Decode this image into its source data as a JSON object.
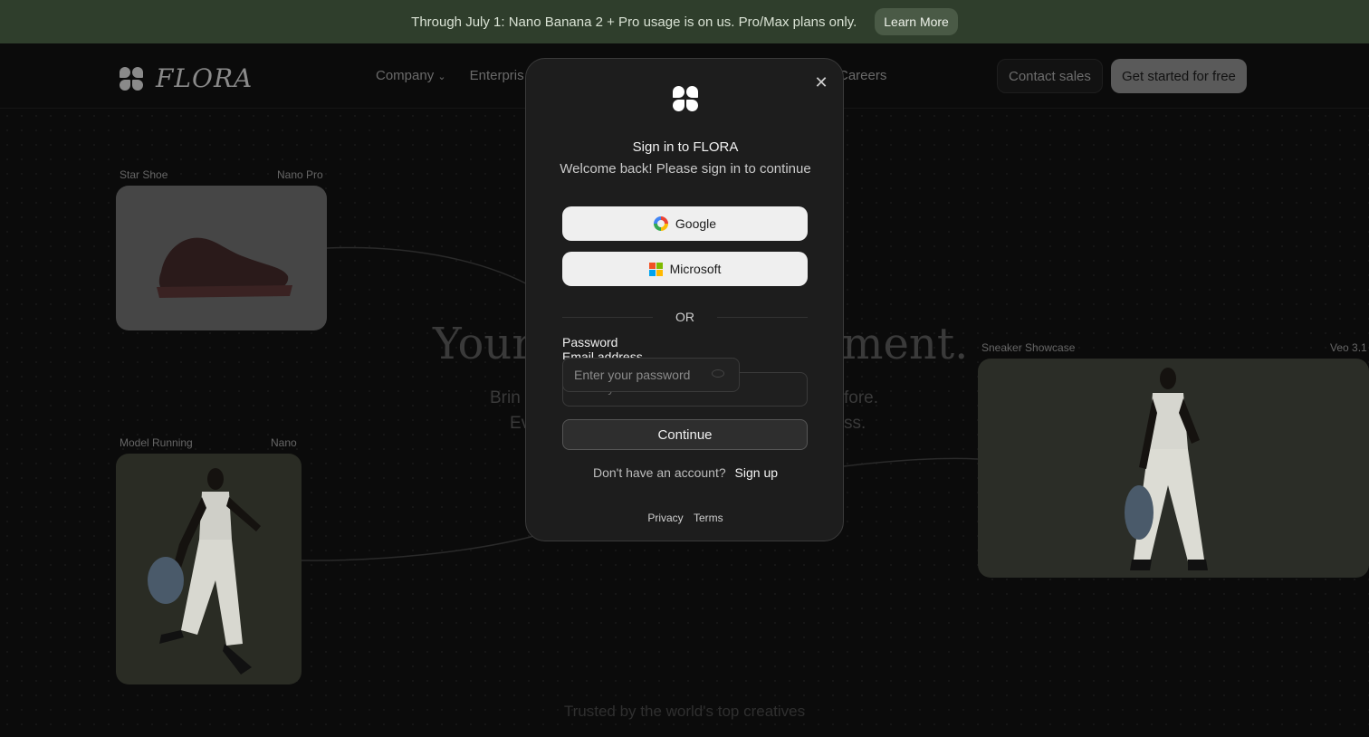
{
  "announcement": {
    "text": "Through July 1: Nano Banana 2 + Pro usage is on us. Pro/Max plans only.",
    "cta": "Learn More"
  },
  "nav": {
    "wordmark": "FLORA",
    "links": [
      "Company",
      "Enterpris"
    ],
    "careers": "Careers",
    "contact": "Contact sales",
    "start": "Get started for free"
  },
  "cards": {
    "shoe": {
      "title": "Star Shoe",
      "model": "Nano Pro"
    },
    "model_running": {
      "title": "Model Running",
      "model": "Nano"
    },
    "sneaker": {
      "title": "Sneaker Showcase",
      "model": "Veo 3.1"
    }
  },
  "hero": {
    "title_left": "Your",
    "title_right": "ment.",
    "sub_left_1": "Brin",
    "sub_left_2": "Ev",
    "sub_right_1": "fore.",
    "sub_right_2": "ss.",
    "trusted": "Trusted by the world's top creatives"
  },
  "modal": {
    "title": "Sign in to FLORA",
    "subtitle": "Welcome back! Please sign in to continue",
    "google": "Google",
    "microsoft": "Microsoft",
    "or": "OR",
    "password_label": "Password",
    "email_label": "Email address",
    "password_placeholder": "Enter your password",
    "email_placeholder": "Enter your email address",
    "continue": "Continue",
    "no_account": "Don't have an account?",
    "signup": "Sign up",
    "privacy": "Privacy",
    "terms": "Terms"
  },
  "colors": {
    "announcement_bg": "#2f3e2c",
    "modal_bg": "#1d1d1d",
    "ms_red": "#f25022",
    "ms_green": "#7fba00",
    "ms_blue": "#00a4ef",
    "ms_yellow": "#ffb900"
  }
}
